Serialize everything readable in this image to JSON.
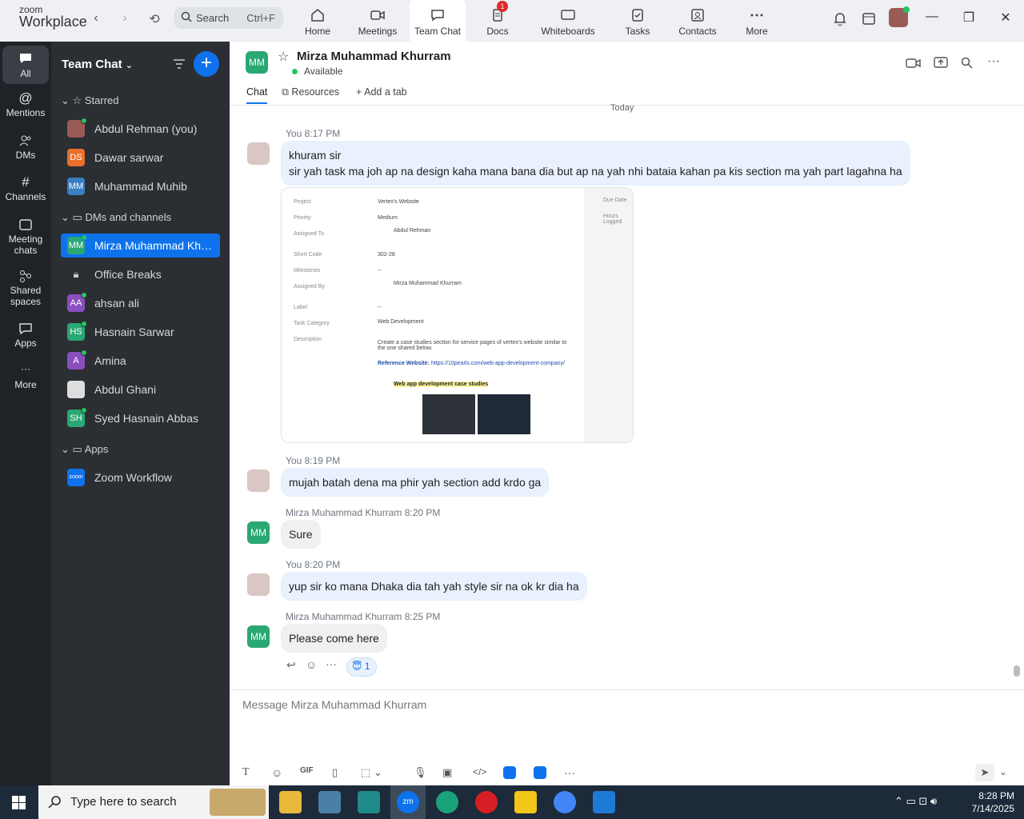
{
  "app": {
    "brand_small": "zoom",
    "brand_large": "Workplace"
  },
  "search": {
    "label": "Search",
    "shortcut": "Ctrl+F"
  },
  "tabs": [
    {
      "label": "Home"
    },
    {
      "label": "Meetings"
    },
    {
      "label": "Team Chat"
    },
    {
      "label": "Docs",
      "badge": "1"
    },
    {
      "label": "Whiteboards"
    },
    {
      "label": "Tasks"
    },
    {
      "label": "Contacts"
    },
    {
      "label": "More"
    }
  ],
  "rail": [
    {
      "label": "All"
    },
    {
      "label": "Mentions"
    },
    {
      "label": "DMs"
    },
    {
      "label": "Channels"
    },
    {
      "label": "Meeting chats"
    },
    {
      "label": "Shared spaces"
    },
    {
      "label": "Apps"
    },
    {
      "label": "More"
    }
  ],
  "sidebar": {
    "title": "Team Chat",
    "starred_label": "Starred",
    "starred": [
      {
        "name": "Abdul Rehman (you)",
        "initials": ""
      },
      {
        "name": "Dawar sarwar",
        "initials": "DS"
      },
      {
        "name": "Muhammad Muhib",
        "initials": "MM"
      }
    ],
    "dms_label": "DMs and channels",
    "dms": [
      {
        "name": "Mirza Muhammad Khurram",
        "initials": "MM"
      },
      {
        "name": "Office Breaks",
        "initials": ""
      },
      {
        "name": "ahsan ali",
        "initials": "AA"
      },
      {
        "name": "Hasnain Sarwar",
        "initials": "HS"
      },
      {
        "name": "Amina",
        "initials": "A"
      },
      {
        "name": "Abdul Ghani",
        "initials": ""
      },
      {
        "name": "Syed Hasnain Abbas",
        "initials": "SH"
      }
    ],
    "apps_label": "Apps",
    "apps": [
      {
        "name": "Zoom Workflow",
        "initials": "zoom"
      }
    ]
  },
  "chat": {
    "initials": "MM",
    "name": "Mirza Muhammad Khurram",
    "status": "Available",
    "tabs": [
      "Chat",
      "Resources",
      "Add a tab"
    ],
    "date_divider": "Today",
    "messages": [
      {
        "sender": "You",
        "time": "8:17 PM",
        "lines": [
          "khuram sir",
          "sir yah task ma joh ap na design kaha mana bana dia but ap na yah nhi bataia kahan pa kis section ma yah part lagahna ha"
        ]
      },
      {
        "sender": "You",
        "time": "8:19 PM",
        "lines": [
          "mujah batah dena ma phir yah section add krdo ga"
        ]
      },
      {
        "sender": "Mirza Muhammad Khurram",
        "time": "8:20 PM",
        "lines": [
          "Sure"
        ]
      },
      {
        "sender": "You",
        "time": "8:20 PM",
        "lines": [
          "yup sir ko mana Dhaka dia tah yah style sir na ok kr dia ha"
        ]
      },
      {
        "sender": "Mirza Muhammad Khurram",
        "time": "8:25 PM",
        "lines": [
          "Please come here"
        ]
      }
    ],
    "reaction": {
      "emoji": "😇",
      "count": "1"
    },
    "image": {
      "rows": [
        [
          "Project",
          "Vertex's Website"
        ],
        [
          "Priority",
          "Medium"
        ],
        [
          "Assigned To",
          "Abdul Rehman"
        ],
        [
          "Short Code",
          "302-28"
        ],
        [
          "Milestones",
          "--"
        ],
        [
          "Assigned By",
          "Mirza Muhammad Khurram"
        ],
        [
          "Label",
          "--"
        ],
        [
          "Task Category",
          "Web Development"
        ],
        [
          "Description",
          "Create a case studies section for service pages of vertex's website similar to the one shared below."
        ]
      ],
      "ref_label": "Reference Website:",
      "ref_url": "https://10pearls.com/web-app-development-company/",
      "case_title": "Web app development case studies",
      "side": [
        "Due Date",
        "Hours Logged"
      ]
    },
    "composer_placeholder": "Message Mirza Muhammad Khurram"
  },
  "taskbar": {
    "search": "Type here to search",
    "time": "8:28 PM",
    "date": "7/14/2025"
  }
}
